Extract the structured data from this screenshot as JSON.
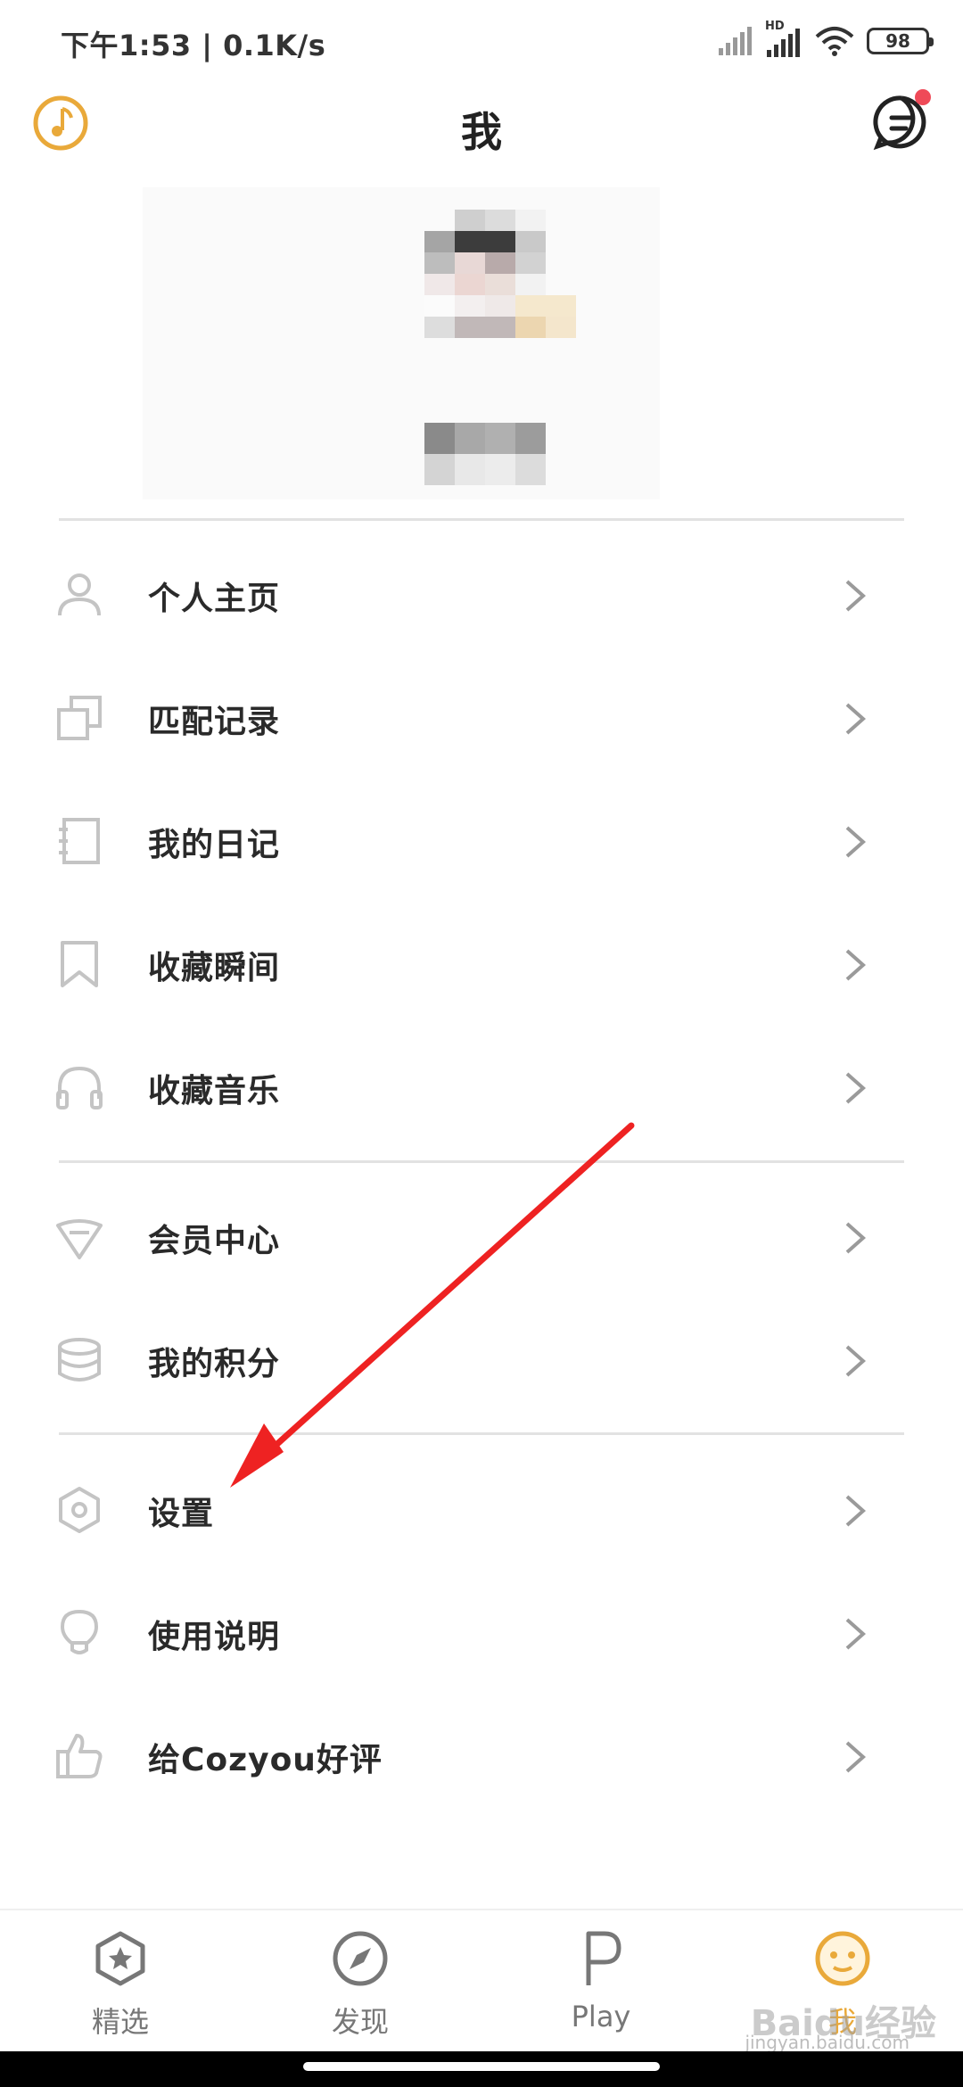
{
  "status_bar": {
    "time": "下午1:53 | 0.1K/s",
    "battery": "98",
    "hd_label": "HD"
  },
  "header": {
    "title": "我"
  },
  "menu": {
    "group1": [
      {
        "label": "个人主页",
        "icon": "person-icon"
      },
      {
        "label": "匹配记录",
        "icon": "match-record-icon"
      },
      {
        "label": "我的日记",
        "icon": "notebook-icon"
      },
      {
        "label": "收藏瞬间",
        "icon": "bookmark-icon"
      },
      {
        "label": "收藏音乐",
        "icon": "headphones-icon"
      }
    ],
    "group2": [
      {
        "label": "会员中心",
        "icon": "diamond-icon"
      },
      {
        "label": "我的积分",
        "icon": "coins-icon"
      }
    ],
    "group3": [
      {
        "label": "设置",
        "icon": "settings-icon"
      },
      {
        "label": "使用说明",
        "icon": "lightbulb-icon"
      },
      {
        "label": "给Cozyou好评",
        "icon": "thumbs-up-icon"
      }
    ]
  },
  "tabbar": {
    "tabs": [
      {
        "label": "精选",
        "icon": "star-badge-icon"
      },
      {
        "label": "发现",
        "icon": "compass-icon"
      },
      {
        "label": "Play",
        "icon": "p-letter-icon"
      },
      {
        "label": "我",
        "icon": "smiley-icon"
      }
    ],
    "active_index": 3
  },
  "colors": {
    "accent": "#e9a93a",
    "notification_dot": "#ef4a58",
    "annotation_arrow": "#ee2222"
  },
  "watermark": {
    "text": "Baidu经验",
    "url": "jingyan.baidu.com"
  }
}
